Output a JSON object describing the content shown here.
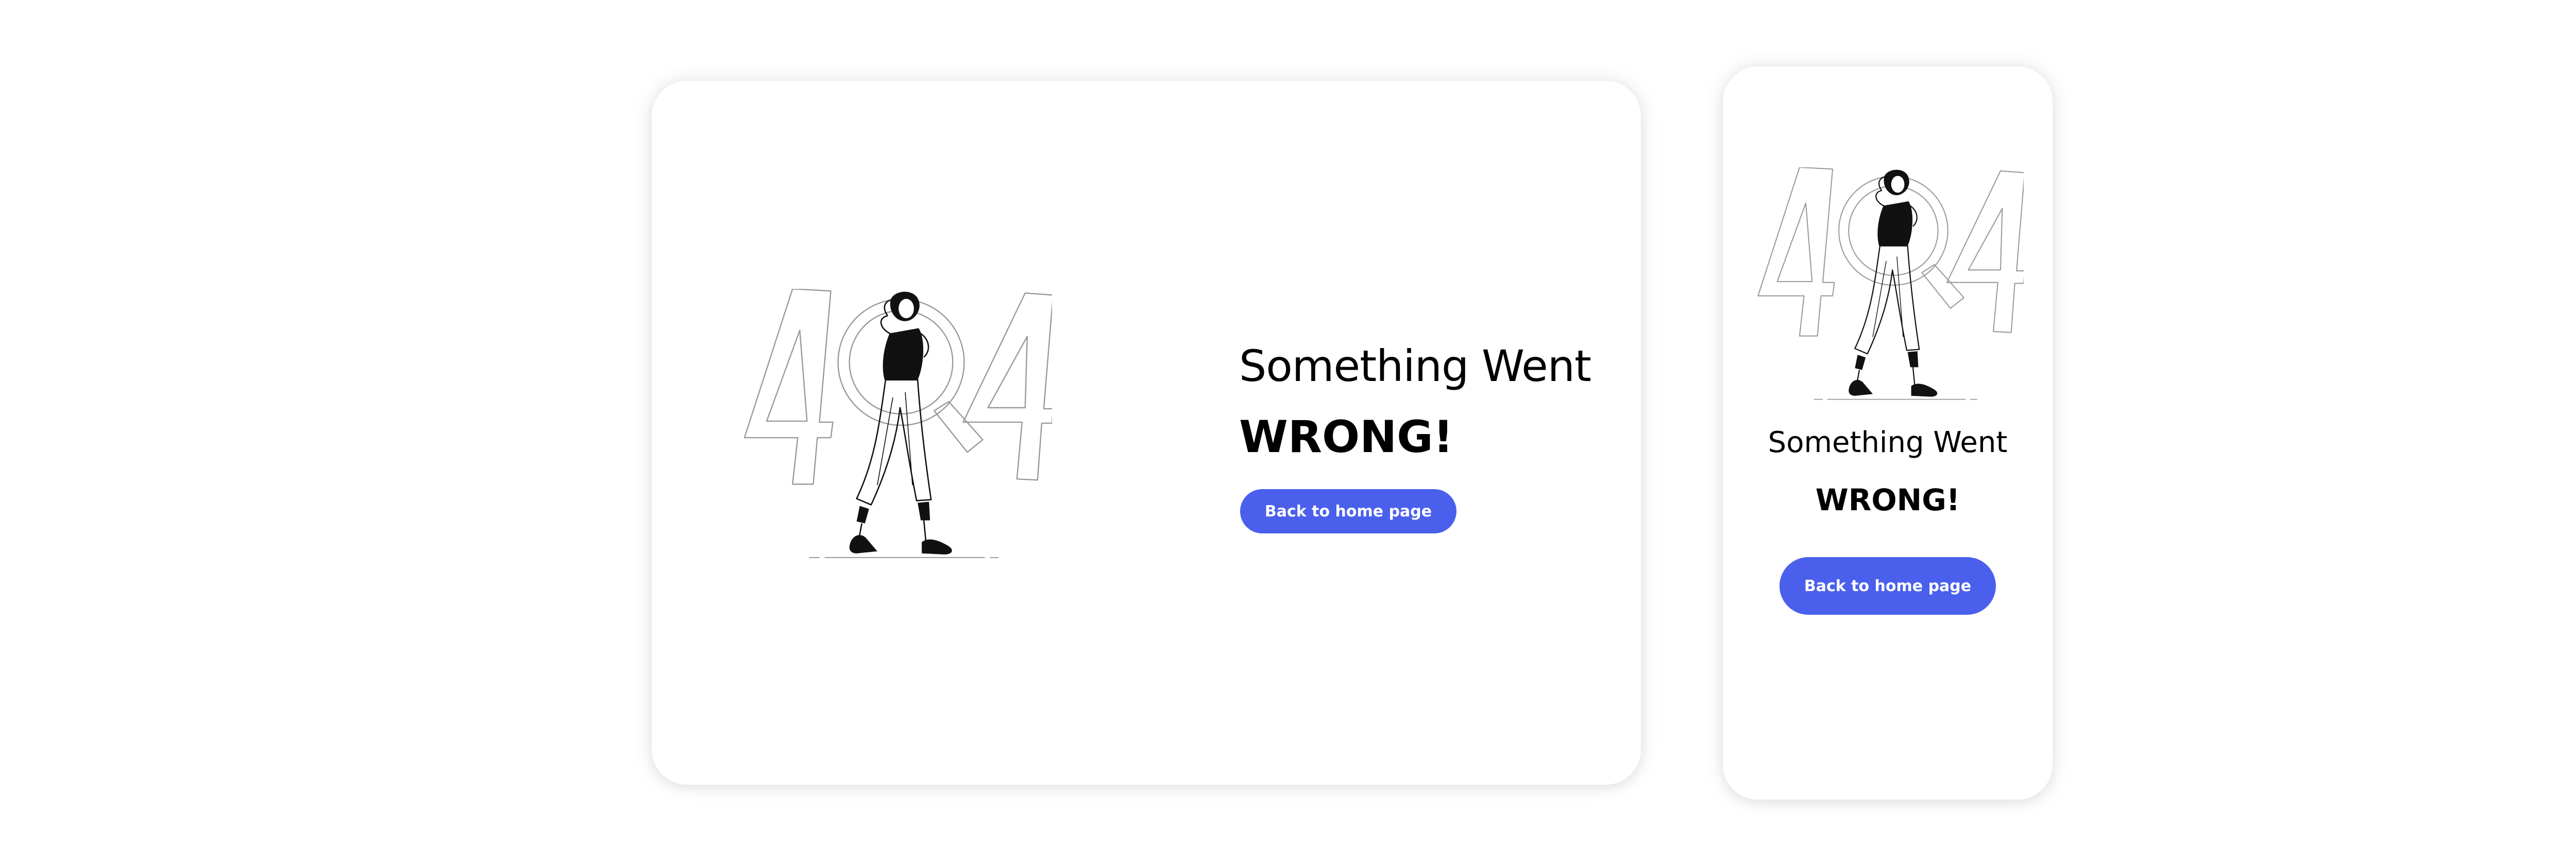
{
  "error_page": {
    "illustration_text": "404",
    "title_line1": "Something Went",
    "title_line2": "WRONG!",
    "home_button_label": "Back to home page"
  },
  "colors": {
    "accent": "#4a60ec",
    "background": "#ffffff",
    "text": "#000000",
    "outline": "#9a9a9a"
  },
  "icons": {
    "illustration": "404-magnifier-illustration"
  }
}
